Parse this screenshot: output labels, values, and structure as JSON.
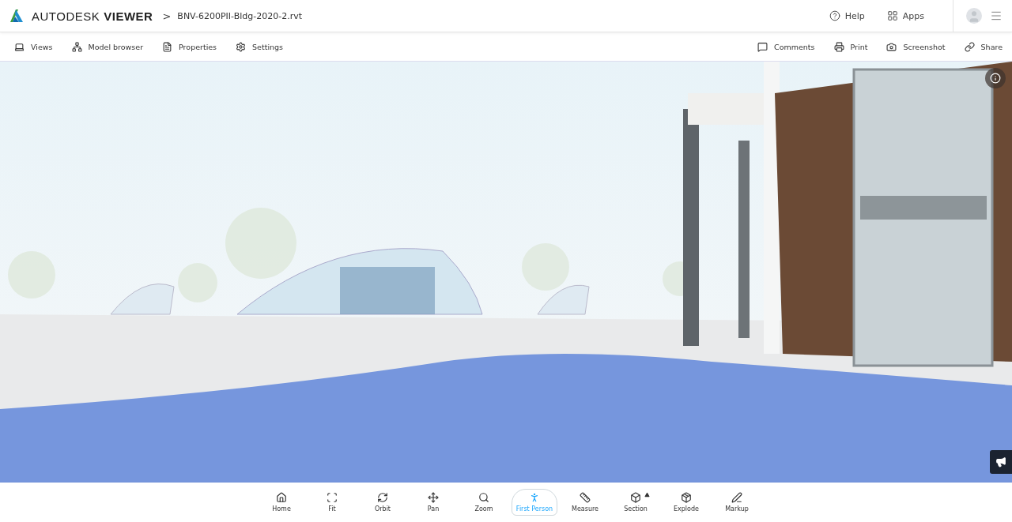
{
  "header": {
    "brand": "AUTODESK",
    "brand_product": "VIEWER",
    "breadcrumb_separator": ">",
    "file_name": "BNV-6200PII-Bldg-2020-2.rvt",
    "links": [
      {
        "kind": "help",
        "label": "Help"
      },
      {
        "kind": "apps",
        "label": "Apps"
      }
    ]
  },
  "toolbar": {
    "left": [
      {
        "kind": "views",
        "label": "Views"
      },
      {
        "kind": "model",
        "label": "Model browser"
      },
      {
        "kind": "properties",
        "label": "Properties"
      },
      {
        "kind": "settings",
        "label": "Settings"
      }
    ],
    "right": [
      {
        "kind": "comments",
        "label": "Comments"
      },
      {
        "kind": "print",
        "label": "Print"
      },
      {
        "kind": "screenshot",
        "label": "Screenshot"
      },
      {
        "kind": "share",
        "label": "Share"
      }
    ]
  },
  "tools": [
    {
      "kind": "home",
      "label": "Home",
      "selected": false
    },
    {
      "kind": "fit",
      "label": "Fit",
      "selected": false
    },
    {
      "kind": "orbit",
      "label": "Orbit",
      "selected": false
    },
    {
      "kind": "pan",
      "label": "Pan",
      "selected": false
    },
    {
      "kind": "zoom",
      "label": "Zoom",
      "selected": false
    },
    {
      "kind": "person",
      "label": "First Person",
      "selected": true
    },
    {
      "kind": "measure",
      "label": "Measure",
      "selected": false
    },
    {
      "kind": "section",
      "label": "Section",
      "selected": false
    },
    {
      "kind": "explode",
      "label": "Explode",
      "selected": false
    },
    {
      "kind": "markup",
      "label": "Markup",
      "selected": false
    }
  ]
}
